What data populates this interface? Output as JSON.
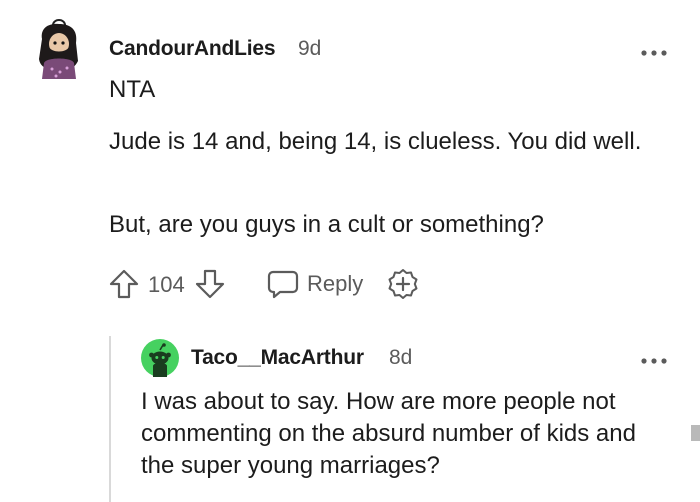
{
  "comment": {
    "username": "CandourAndLies",
    "age": "9d",
    "paragraphs": [
      "NTA",
      "Jude is 14 and, being 14, is clueless. You did well.",
      "But, are you guys in a cult or something?"
    ],
    "vote_count": "104",
    "reply_label": "Reply",
    "icons": [
      "upvote-icon",
      "downvote-icon",
      "reply-icon",
      "award-icon",
      "more-options-icon"
    ]
  },
  "reply": {
    "username": "Taco__MacArthur",
    "age": "8d",
    "body": "I was about to say. How are more people not commenting on the absurd number of kids and the super young marriages?",
    "icons": [
      "snoo-avatar-icon",
      "more-options-icon"
    ]
  },
  "colors": {
    "text": "#1c1c1c",
    "meta": "#5b5b5b",
    "thread_line": "#d9d9d9",
    "reply_avatar_bg": "#46d160"
  }
}
